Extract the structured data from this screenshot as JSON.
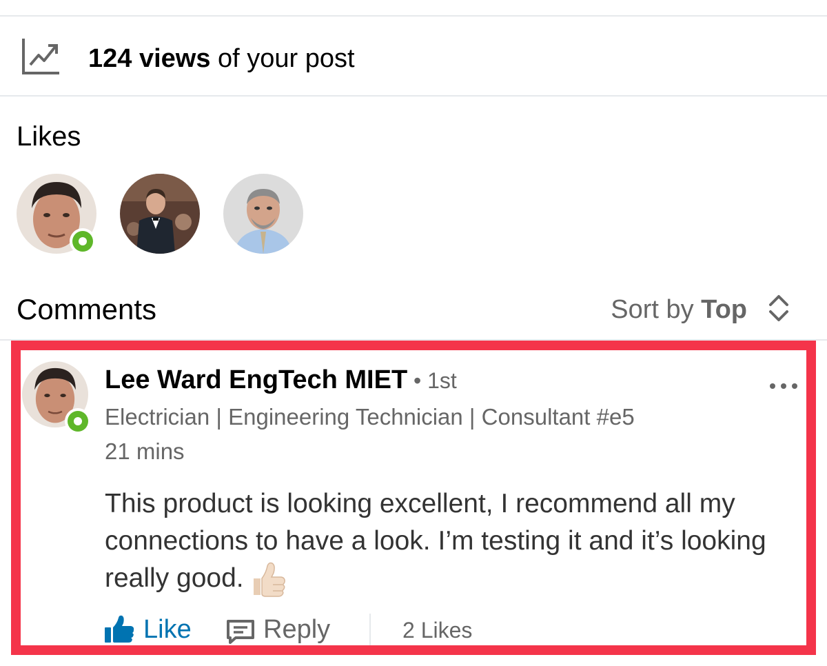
{
  "analytics": {
    "count": "124 views",
    "suffix": " of your post",
    "icon": "analytics-chart-icon"
  },
  "likes": {
    "title": "Likes",
    "avatars": [
      {
        "name": "liker-avatar-1",
        "online": true
      },
      {
        "name": "liker-avatar-2",
        "online": false
      },
      {
        "name": "liker-avatar-3",
        "online": false
      }
    ]
  },
  "comments": {
    "title": "Comments",
    "sort_prefix": "Sort by ",
    "sort_value": "Top",
    "sort_icon": "sort-chevrons-icon"
  },
  "comment": {
    "author": "Lee Ward EngTech MIET",
    "degree": "• 1st",
    "headline": "Electrician | Engineering Technician | Consultant #e5",
    "time": "21 mins",
    "text": "This product is looking excellent, I recommend all my connections to have a look. I’m testing it and it’s looking really good.",
    "more_icon": "more-options-icon",
    "like_label": "Like",
    "reply_label": "Reply",
    "likes_count": "2 Likes",
    "highlight_color": "#f4344a"
  },
  "colors": {
    "link_blue": "#0073b1",
    "presence_green": "#5fb72a",
    "secondary_text": "#666666"
  }
}
